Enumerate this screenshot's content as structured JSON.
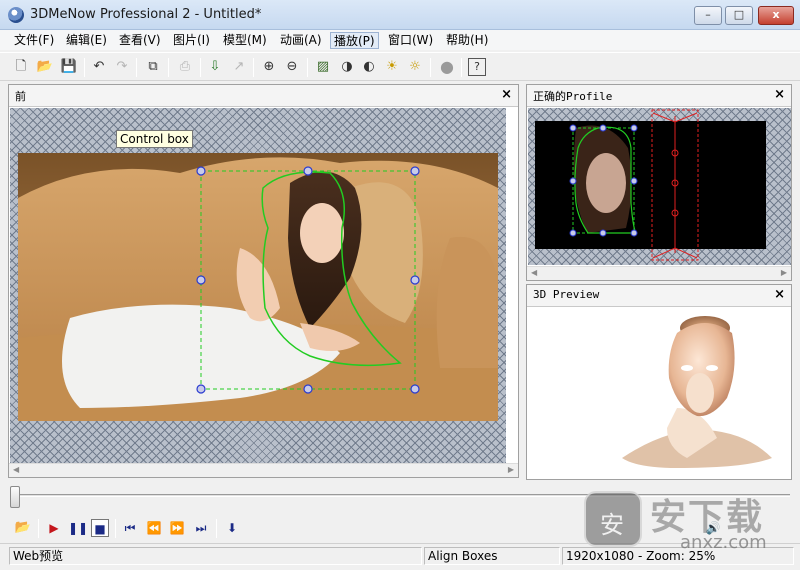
{
  "window": {
    "title": "3DMeNow Professional 2 - Untitled*",
    "min_label": "–",
    "max_label": "□",
    "close_label": "x"
  },
  "menu": {
    "items": [
      {
        "label": "文件(F)"
      },
      {
        "label": "编辑(E)"
      },
      {
        "label": "查看(V)"
      },
      {
        "label": "图片(I)"
      },
      {
        "label": "模型(M)"
      },
      {
        "label": "动画(A)"
      },
      {
        "label": "播放(P)"
      },
      {
        "label": "窗口(W)"
      },
      {
        "label": "帮助(H)"
      }
    ],
    "active_index": 6
  },
  "toolbar": {
    "icons": [
      "new-file",
      "open-folder",
      "save",
      "undo",
      "redo",
      "fit-frame",
      "print",
      "import",
      "export",
      "zoom-in",
      "zoom-out",
      "image",
      "contrast",
      "color-balance",
      "brightness",
      "color-adjust",
      "record",
      "help"
    ]
  },
  "front_panel": {
    "title": "前",
    "close": "×",
    "tooltip": "Control box"
  },
  "profile_panel": {
    "title": "正确的Profile",
    "close": "×"
  },
  "preview_panel": {
    "title": "3D Preview",
    "close": "×"
  },
  "transport": {
    "icons": [
      "open-folder",
      "play",
      "pause",
      "stop",
      "go-start",
      "rewind",
      "fast-forward",
      "go-end",
      "export-animation"
    ]
  },
  "status": {
    "left": "Web预览",
    "middle": "Align Boxes",
    "right": "1920x1080 - Zoom: 25%"
  },
  "watermark": {
    "text": "安下载",
    "sub": "anxz.com",
    "badge": "安"
  },
  "colors": {
    "fit_curve": "#22cc22",
    "control_box": "#22cc22",
    "profile_line": "#e02020",
    "handle": "#2a3bd0"
  }
}
